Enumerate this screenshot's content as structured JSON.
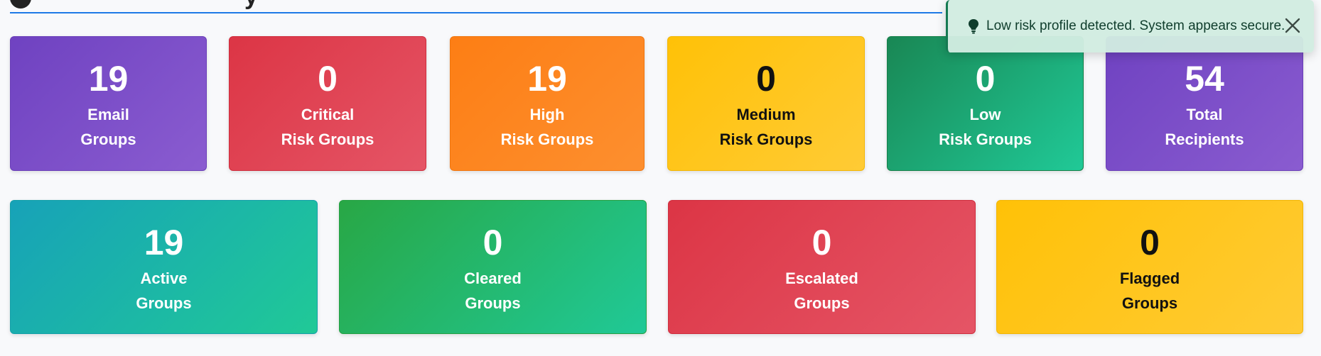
{
  "header": {
    "partial_title": "y"
  },
  "toast": {
    "icon": "lightbulb-icon",
    "message": "Low risk profile detected. System appears secure.",
    "close_icon": "close-icon"
  },
  "row1": [
    {
      "value": "19",
      "line1": "Email",
      "line2": "Groups",
      "color": "#6f42c1"
    },
    {
      "value": "0",
      "line1": "Critical",
      "line2": "Risk Groups",
      "color": "#dc3545"
    },
    {
      "value": "19",
      "line1": "High",
      "line2": "Risk Groups",
      "color": "#fd7e14"
    },
    {
      "value": "0",
      "line1": "Medium",
      "line2": "Risk Groups",
      "color": "#ffc107"
    },
    {
      "value": "0",
      "line1": "Low",
      "line2": "Risk Groups",
      "color": "#198754"
    },
    {
      "value": "54",
      "line1": "Total",
      "line2": "Recipients",
      "color": "#6f42c1"
    }
  ],
  "row2": [
    {
      "value": "19",
      "line1": "Active",
      "line2": "Groups",
      "color": "#17a2b8"
    },
    {
      "value": "0",
      "line1": "Cleared",
      "line2": "Groups",
      "color": "#28a745"
    },
    {
      "value": "0",
      "line1": "Escalated",
      "line2": "Groups",
      "color": "#dc3545"
    },
    {
      "value": "0",
      "line1": "Flagged",
      "line2": "Groups",
      "color": "#ffc107"
    }
  ]
}
